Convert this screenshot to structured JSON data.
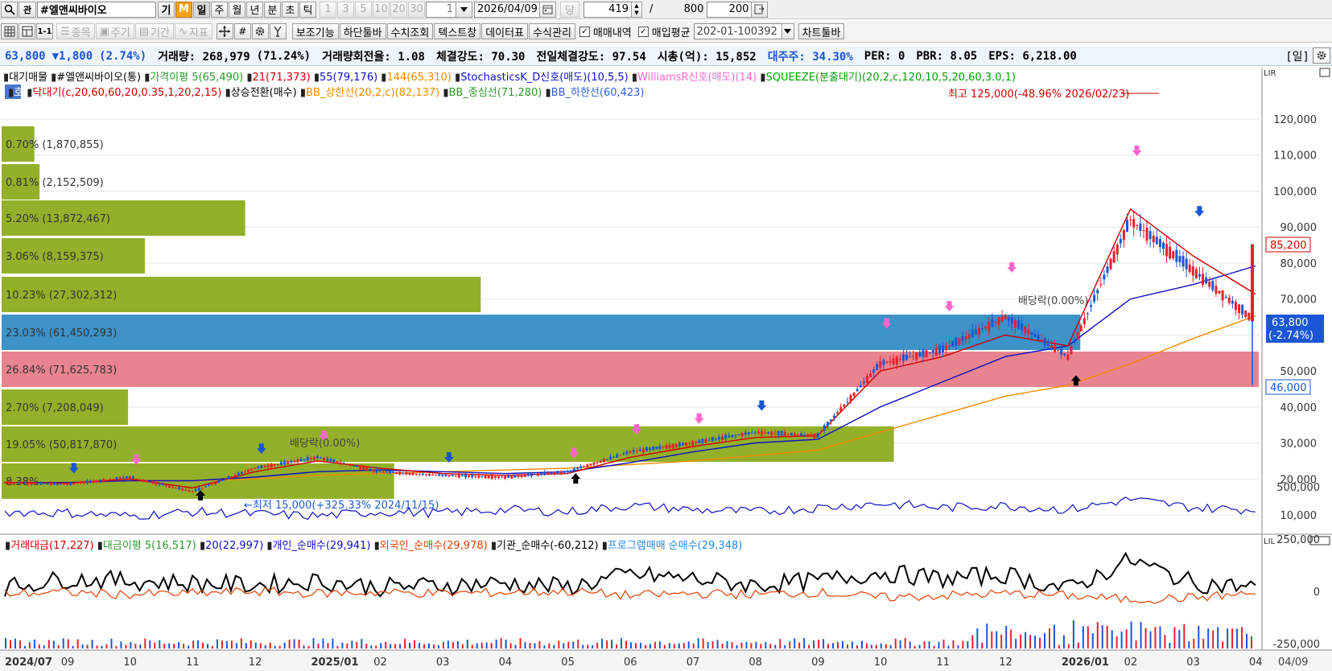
{
  "toolbar1": {
    "search_icon": "search-icon",
    "stock_name": "#엘앤씨바이오",
    "kiwoom_label": "기",
    "m_label": "M",
    "periods": [
      "일",
      "주",
      "월",
      "년",
      "분",
      "초",
      "틱"
    ],
    "minute_values": [
      "1",
      "3",
      "5",
      "10",
      "20",
      "30"
    ],
    "interval_value": "1",
    "date_value": "2026/04/09",
    "dang_label": "당",
    "count_value": "419",
    "slash": "/",
    "total_value": "800",
    "zoom_value": "200"
  },
  "toolbar2": {
    "icon_buttons": [
      "grid-icon",
      "layout-icon",
      "1-1"
    ],
    "item_btn": "종목",
    "period_btn": "주기",
    "range_btn": "기간",
    "indicator_btn": "지표",
    "text_buttons": [
      "보조기능",
      "하단툴바",
      "수치조회",
      "텍스트창",
      "데이터표",
      "수식관리"
    ],
    "check1_label": "매매내역",
    "check2_label": "매입평균",
    "account_value": "202-01-100392",
    "chart_toolbar_btn": "차트툴바"
  },
  "info_bar": {
    "price": "63,800",
    "change": "▼1,800",
    "change_pct": "(2.74%)",
    "volume": "거래량: 268,979",
    "volume_pct": "(71.24%)",
    "turnover": "거래량회전율: 1.08",
    "strength": "체결강도: 70.30",
    "prev_strength": "전일체결강도: 97.54",
    "marketcap": "시총(억): 15,852",
    "major": "대주주: 34.30%",
    "per": "PER: 0",
    "pbr": "PBR: 8.05",
    "eps": "EPS: 6,218.00",
    "period_tag": "[일]"
  },
  "legend1": [
    {
      "t": "대기매물",
      "c": "#000"
    },
    {
      "t": "#엘앤씨바이오(통)",
      "c": "#000"
    },
    {
      "t": "가격이평 5(65,490)",
      "c": "#2a9a2a"
    },
    {
      "t": "21(71,373)",
      "c": "#d00000"
    },
    {
      "t": "55(79,176)",
      "c": "#1010c0"
    },
    {
      "t": "144(65,310)",
      "c": "#f08a00"
    },
    {
      "t": "StochasticsK_D신호(매도)(10,5,5)",
      "c": "#1010c0"
    },
    {
      "t": "WilliamsR신호(매도)(14)",
      "c": "#ff66cc"
    },
    {
      "t": "SQUEEZE(분출대기)(20,2,c,120,10,5,20,60,3.0,1)",
      "c": "#00a000"
    }
  ],
  "legend2": [
    {
      "t": "호",
      "c": "#fff"
    },
    {
      "t": "닥대기(c,20,60,60,20,0.35,1,20,2,15)",
      "c": "#d00000"
    },
    {
      "t": "상승전환(매수)",
      "c": "#000"
    },
    {
      "t": "BB_상한선(20,2,c)(82,137)",
      "c": "#f08a00"
    },
    {
      "t": "BB_중심선(71,280)",
      "c": "#2a9a2a"
    },
    {
      "t": "BB_하한선(60,423)",
      "c": "#3060e0"
    }
  ],
  "annotations": {
    "high": "최고 125,000(-48.96% 2026/02/23)",
    "low": "←최저 15,000(+325.33% 2024/11/15)",
    "div1": "배당락(0.00%)",
    "div2": "배당락(0.00%)"
  },
  "price_badges": {
    "upper": "85,200",
    "current": "63,800",
    "current_pct": "(-2.74%)",
    "lower": "46,000"
  },
  "y_axis": {
    "ticks": [
      "120,000",
      "110,000",
      "100,000",
      "90,000",
      "80,000",
      "70,000",
      "60,000",
      "50,000",
      "40,000",
      "30,000",
      "20,000",
      "10,000"
    ]
  },
  "volume_profile": [
    {
      "label": "0.70% (1,870,855)",
      "pct": 0.7,
      "color": "#93b02a"
    },
    {
      "label": "0.81% (2,152,509)",
      "pct": 0.81,
      "color": "#93b02a"
    },
    {
      "label": "5.20% (13,872,467)",
      "pct": 5.2,
      "color": "#93b02a"
    },
    {
      "label": "3.06% (8,159,375)",
      "pct": 3.06,
      "color": "#93b02a"
    },
    {
      "label": "10.23% (27,302,312)",
      "pct": 10.23,
      "color": "#93b02a"
    },
    {
      "label": "23.03% (61,450,293)",
      "pct": 23.03,
      "color": "#3d92c8"
    },
    {
      "label": "26.84% (71,625,783)",
      "pct": 26.84,
      "color": "#e8848f"
    },
    {
      "label": "2.70% (7,208,049)",
      "pct": 2.7,
      "color": "#93b02a"
    },
    {
      "label": "19.05% (50,817,870)",
      "pct": 19.05,
      "color": "#93b02a"
    },
    {
      "label": "8.38%",
      "pct": 8.38,
      "color": "#93b02a"
    }
  ],
  "legend3": [
    {
      "t": "거래대금(17,227)",
      "c": "#d00000"
    },
    {
      "t": "대금이평 5(16,517)",
      "c": "#2a9a2a"
    },
    {
      "t": "20(22,997)",
      "c": "#1010c0"
    },
    {
      "t": "개인_순매수(29,941)",
      "c": "#1010c0"
    },
    {
      "t": "외국인_순매수(29,978)",
      "c": "#e04000"
    },
    {
      "t": "기관_순매수(-60,212)",
      "c": "#000"
    },
    {
      "t": "프로그램매매 순매수(29,348)",
      "c": "#1e88e5"
    }
  ],
  "lower_y": {
    "ticks": [
      "500,000",
      "250,000",
      "0",
      "-250,000"
    ]
  },
  "x_axis": {
    "labels": [
      "2024/07",
      "09",
      "10",
      "11",
      "12",
      "2025/01",
      "02",
      "03",
      "04",
      "05",
      "06",
      "07",
      "08",
      "09",
      "10",
      "11",
      "12",
      "2026/01",
      "02",
      "03",
      "04"
    ],
    "end_date": "04/09"
  },
  "panel_icons": {
    "lir": "LIR",
    "dock_icon": "dock-icon",
    "lil": "LIL",
    "split_icon": "split-icon",
    "settings_icon": "gear-icon"
  },
  "chart_data": {
    "type": "candlestick",
    "ylim": [
      5000,
      125000
    ],
    "x": [
      "2024/07",
      "2024/09",
      "2024/10",
      "2024/11",
      "2024/12",
      "2025/01",
      "2025/02",
      "2025/03",
      "2025/04",
      "2025/05",
      "2025/06",
      "2025/07",
      "2025/08",
      "2025/09",
      "2025/10",
      "2025/11",
      "2025/12",
      "2026/01",
      "2026/02",
      "2026/03",
      "2026/04"
    ],
    "close": [
      19000,
      18500,
      20500,
      16500,
      23000,
      26000,
      22000,
      21000,
      20500,
      22000,
      27500,
      30000,
      33000,
      32000,
      52000,
      56000,
      65000,
      54000,
      92000,
      78000,
      63800
    ],
    "series": [
      {
        "name": "144",
        "values": [
          19000,
          19000,
          19500,
          19500,
          20000,
          21000,
          21500,
          22000,
          22500,
          23000,
          24000,
          25000,
          26500,
          28000,
          33000,
          38000,
          43000,
          46000,
          52000,
          59000,
          65310
        ]
      },
      {
        "name": "55",
        "values": [
          19000,
          19000,
          19500,
          19500,
          20500,
          22000,
          22500,
          22000,
          21500,
          22000,
          24500,
          27500,
          30000,
          31000,
          40000,
          47000,
          54000,
          57000,
          70000,
          74000,
          79176
        ]
      },
      {
        "name": "21",
        "values": [
          19000,
          18800,
          20000,
          17500,
          22000,
          25000,
          23000,
          21500,
          21000,
          21500,
          26000,
          29000,
          31500,
          32000,
          50000,
          54000,
          60000,
          57000,
          95000,
          82000,
          71373
        ]
      }
    ],
    "lower_type": "line",
    "lower_ylim": [
      -300000,
      650000
    ],
    "lower_series": [
      {
        "name": "개인_순매수",
        "values": [
          380000,
          375000,
          360000,
          380000,
          370000,
          360000,
          380000,
          375000,
          390000,
          380000,
          410000,
          390000,
          380000,
          400000,
          420000,
          400000,
          410000,
          390000,
          440000,
          400000,
          390000
        ]
      },
      {
        "name": "기관_순매수",
        "values": [
          20000,
          60000,
          50000,
          40000,
          30000,
          50000,
          20000,
          30000,
          40000,
          20000,
          80000,
          60000,
          30000,
          50000,
          90000,
          60000,
          80000,
          10000,
          150000,
          40000,
          20000
        ]
      },
      {
        "name": "외국인_순매수",
        "values": [
          -10000,
          -5000,
          -15000,
          -10000,
          0,
          -10000,
          -5000,
          -10000,
          -5000,
          0,
          -20000,
          -10000,
          -15000,
          -5000,
          -30000,
          -20000,
          -10000,
          -20000,
          -40000,
          -30000,
          -10000
        ]
      }
    ]
  }
}
